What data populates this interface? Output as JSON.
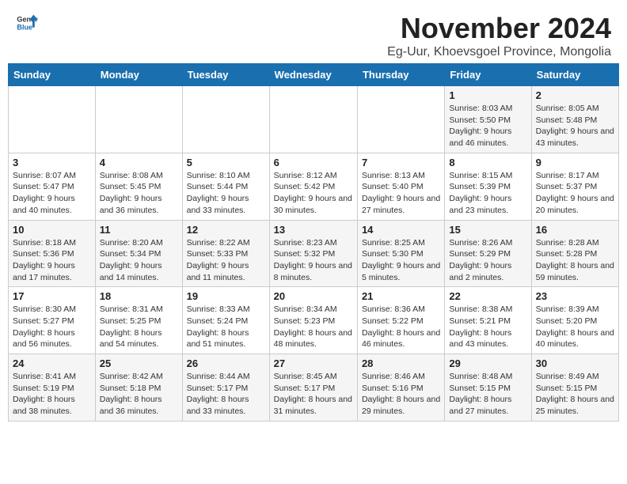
{
  "header": {
    "logo_general": "General",
    "logo_blue": "Blue",
    "title": "November 2024",
    "subtitle": "Eg-Uur, Khoevsgoel Province, Mongolia"
  },
  "days_of_week": [
    "Sunday",
    "Monday",
    "Tuesday",
    "Wednesday",
    "Thursday",
    "Friday",
    "Saturday"
  ],
  "weeks": [
    [
      {
        "day": "",
        "info": ""
      },
      {
        "day": "",
        "info": ""
      },
      {
        "day": "",
        "info": ""
      },
      {
        "day": "",
        "info": ""
      },
      {
        "day": "",
        "info": ""
      },
      {
        "day": "1",
        "info": "Sunrise: 8:03 AM\nSunset: 5:50 PM\nDaylight: 9 hours and 46 minutes."
      },
      {
        "day": "2",
        "info": "Sunrise: 8:05 AM\nSunset: 5:48 PM\nDaylight: 9 hours and 43 minutes."
      }
    ],
    [
      {
        "day": "3",
        "info": "Sunrise: 8:07 AM\nSunset: 5:47 PM\nDaylight: 9 hours and 40 minutes."
      },
      {
        "day": "4",
        "info": "Sunrise: 8:08 AM\nSunset: 5:45 PM\nDaylight: 9 hours and 36 minutes."
      },
      {
        "day": "5",
        "info": "Sunrise: 8:10 AM\nSunset: 5:44 PM\nDaylight: 9 hours and 33 minutes."
      },
      {
        "day": "6",
        "info": "Sunrise: 8:12 AM\nSunset: 5:42 PM\nDaylight: 9 hours and 30 minutes."
      },
      {
        "day": "7",
        "info": "Sunrise: 8:13 AM\nSunset: 5:40 PM\nDaylight: 9 hours and 27 minutes."
      },
      {
        "day": "8",
        "info": "Sunrise: 8:15 AM\nSunset: 5:39 PM\nDaylight: 9 hours and 23 minutes."
      },
      {
        "day": "9",
        "info": "Sunrise: 8:17 AM\nSunset: 5:37 PM\nDaylight: 9 hours and 20 minutes."
      }
    ],
    [
      {
        "day": "10",
        "info": "Sunrise: 8:18 AM\nSunset: 5:36 PM\nDaylight: 9 hours and 17 minutes."
      },
      {
        "day": "11",
        "info": "Sunrise: 8:20 AM\nSunset: 5:34 PM\nDaylight: 9 hours and 14 minutes."
      },
      {
        "day": "12",
        "info": "Sunrise: 8:22 AM\nSunset: 5:33 PM\nDaylight: 9 hours and 11 minutes."
      },
      {
        "day": "13",
        "info": "Sunrise: 8:23 AM\nSunset: 5:32 PM\nDaylight: 9 hours and 8 minutes."
      },
      {
        "day": "14",
        "info": "Sunrise: 8:25 AM\nSunset: 5:30 PM\nDaylight: 9 hours and 5 minutes."
      },
      {
        "day": "15",
        "info": "Sunrise: 8:26 AM\nSunset: 5:29 PM\nDaylight: 9 hours and 2 minutes."
      },
      {
        "day": "16",
        "info": "Sunrise: 8:28 AM\nSunset: 5:28 PM\nDaylight: 8 hours and 59 minutes."
      }
    ],
    [
      {
        "day": "17",
        "info": "Sunrise: 8:30 AM\nSunset: 5:27 PM\nDaylight: 8 hours and 56 minutes."
      },
      {
        "day": "18",
        "info": "Sunrise: 8:31 AM\nSunset: 5:25 PM\nDaylight: 8 hours and 54 minutes."
      },
      {
        "day": "19",
        "info": "Sunrise: 8:33 AM\nSunset: 5:24 PM\nDaylight: 8 hours and 51 minutes."
      },
      {
        "day": "20",
        "info": "Sunrise: 8:34 AM\nSunset: 5:23 PM\nDaylight: 8 hours and 48 minutes."
      },
      {
        "day": "21",
        "info": "Sunrise: 8:36 AM\nSunset: 5:22 PM\nDaylight: 8 hours and 46 minutes."
      },
      {
        "day": "22",
        "info": "Sunrise: 8:38 AM\nSunset: 5:21 PM\nDaylight: 8 hours and 43 minutes."
      },
      {
        "day": "23",
        "info": "Sunrise: 8:39 AM\nSunset: 5:20 PM\nDaylight: 8 hours and 40 minutes."
      }
    ],
    [
      {
        "day": "24",
        "info": "Sunrise: 8:41 AM\nSunset: 5:19 PM\nDaylight: 8 hours and 38 minutes."
      },
      {
        "day": "25",
        "info": "Sunrise: 8:42 AM\nSunset: 5:18 PM\nDaylight: 8 hours and 36 minutes."
      },
      {
        "day": "26",
        "info": "Sunrise: 8:44 AM\nSunset: 5:17 PM\nDaylight: 8 hours and 33 minutes."
      },
      {
        "day": "27",
        "info": "Sunrise: 8:45 AM\nSunset: 5:17 PM\nDaylight: 8 hours and 31 minutes."
      },
      {
        "day": "28",
        "info": "Sunrise: 8:46 AM\nSunset: 5:16 PM\nDaylight: 8 hours and 29 minutes."
      },
      {
        "day": "29",
        "info": "Sunrise: 8:48 AM\nSunset: 5:15 PM\nDaylight: 8 hours and 27 minutes."
      },
      {
        "day": "30",
        "info": "Sunrise: 8:49 AM\nSunset: 5:15 PM\nDaylight: 8 hours and 25 minutes."
      }
    ]
  ]
}
